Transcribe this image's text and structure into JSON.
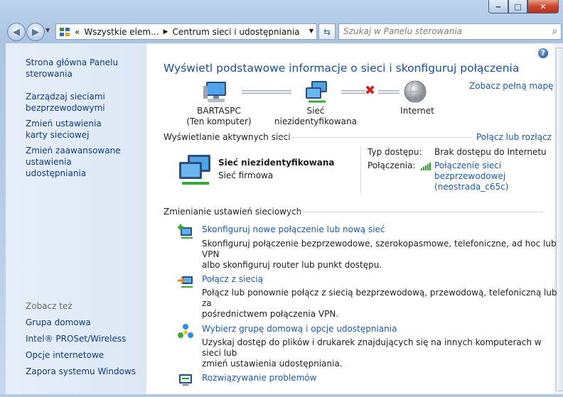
{
  "window": {
    "controls": {
      "minimize": "‒",
      "maximize": "□",
      "close": "✕"
    }
  },
  "address": {
    "overflow": "«",
    "crumbs": [
      "Wszystkie elem...",
      "Centrum sieci i udostępniania"
    ]
  },
  "search": {
    "placeholder": "Szukaj w Panelu sterowania"
  },
  "sidebar": {
    "top_links": [
      "Strona główna Panelu sterowania",
      "Zarządzaj sieciami bezprzewodowymi",
      "Zmień ustawienia karty sieciowej",
      "Zmień zaawansowane ustawienia udostępniania"
    ],
    "see_also_heading": "Zobacz też",
    "see_also": [
      "Grupa domowa",
      "Intel® PROSet/Wireless",
      "Opcje internetowe",
      "Zapora systemu Windows"
    ]
  },
  "main": {
    "title": "Wyświetl podstawowe informacje o sieci i skonfiguruj połączenia",
    "full_map_link": "Zobacz pełną mapę",
    "map": {
      "computer_name": "BARTASPC",
      "computer_sub": "(Ten komputer)",
      "network": "Sieć niezidentyfikowana",
      "internet": "Internet"
    },
    "active": {
      "heading": "Wyświetlanie aktywnych sieci",
      "connect_link": "Połącz lub rozłącz",
      "name": "Sieć niezidentyfikowana",
      "type": "Sieć firmowa",
      "access_label": "Typ dostępu:",
      "access_value": "Brak dostępu do Internetu",
      "conn_label": "Połączenia:",
      "conn_value_1": "Połączenie sieci",
      "conn_value_2": "bezprzewodowej",
      "conn_value_3": "(neostrada_c65c)"
    },
    "change": {
      "heading": "Zmienianie ustawień sieciowych",
      "tasks": [
        {
          "title": "Skonfiguruj nowe połączenie lub nową sieć",
          "desc1": "Skonfiguruj połączenie bezprzewodowe, szerokopasmowe, telefoniczne, ad hoc lub VPN",
          "desc2": "albo skonfiguruj router lub punkt dostępu."
        },
        {
          "title": "Połącz z siecią",
          "desc1": "Połącz lub ponownie połącz z siecią bezprzewodową, przewodową, telefoniczną lub za",
          "desc2": "pośrednictwem połączenia VPN."
        },
        {
          "title": "Wybierz grupę domową i opcje udostępniania",
          "desc1": "Uzyskaj dostęp do plików i drukarek znajdujących się na innych komputerach w sieci lub",
          "desc2": "zmień ustawienia udostępniania."
        },
        {
          "title": "Rozwiązywanie problemów",
          "desc1": "",
          "desc2": ""
        }
      ]
    }
  }
}
